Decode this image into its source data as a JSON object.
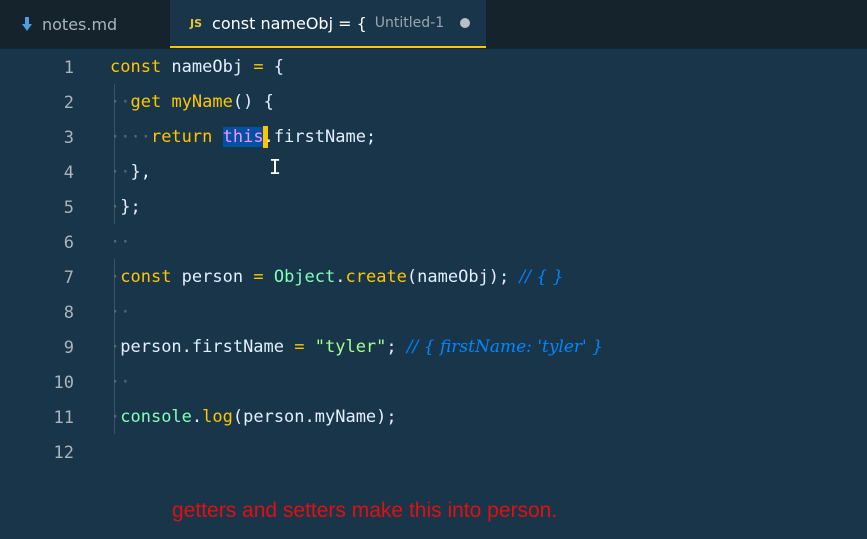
{
  "tabs": [
    {
      "label": "notes.md",
      "icon": "markdown-download-icon",
      "active": false
    },
    {
      "label": "const nameObj = {",
      "sublabel": "Untitled-1",
      "icon_text": "JS",
      "active": true,
      "dirty": true
    }
  ],
  "editor": {
    "line_numbers": [
      "1",
      "2",
      "3",
      "4",
      "5",
      "6",
      "7",
      "8",
      "9",
      "10",
      "11",
      "12"
    ],
    "selected_word": "this",
    "annotation": "getters and setters make this into person."
  },
  "colors": {
    "background": "#193549",
    "keyword": "#ffc600",
    "this_keyword": "#fb94ff",
    "string": "#a5ff90",
    "comment": "#0088ff",
    "annotation": "#e01010"
  }
}
